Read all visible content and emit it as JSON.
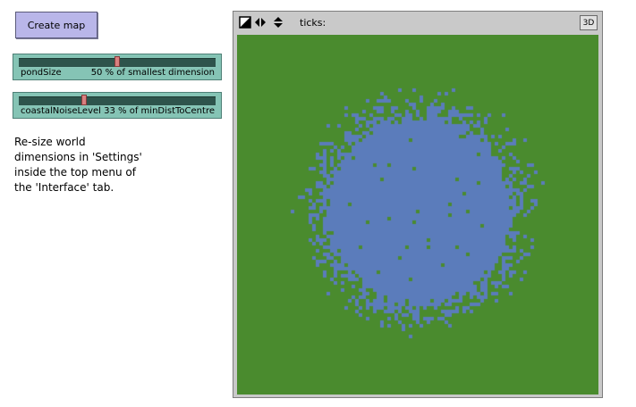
{
  "create_button": {
    "label": "Create map"
  },
  "sliders": [
    {
      "name": "pondSize",
      "value": 50,
      "value_text": "50 % of smallest dimension",
      "fraction": 0.5
    },
    {
      "name": "coastalNoiseLevel",
      "value": 33,
      "value_text": "33 % of minDistToCentre",
      "fraction": 0.33
    }
  ],
  "note": "Re-size world\ndimensions in 'Settings'\ninside the top menu of\nthe 'Interface' tab.",
  "view": {
    "ticks_label": "ticks:",
    "three_d_label": "3D",
    "colors": {
      "land": "#4a8b2e",
      "water": "#5b7cbb",
      "frame": "#c9c9c9"
    }
  }
}
